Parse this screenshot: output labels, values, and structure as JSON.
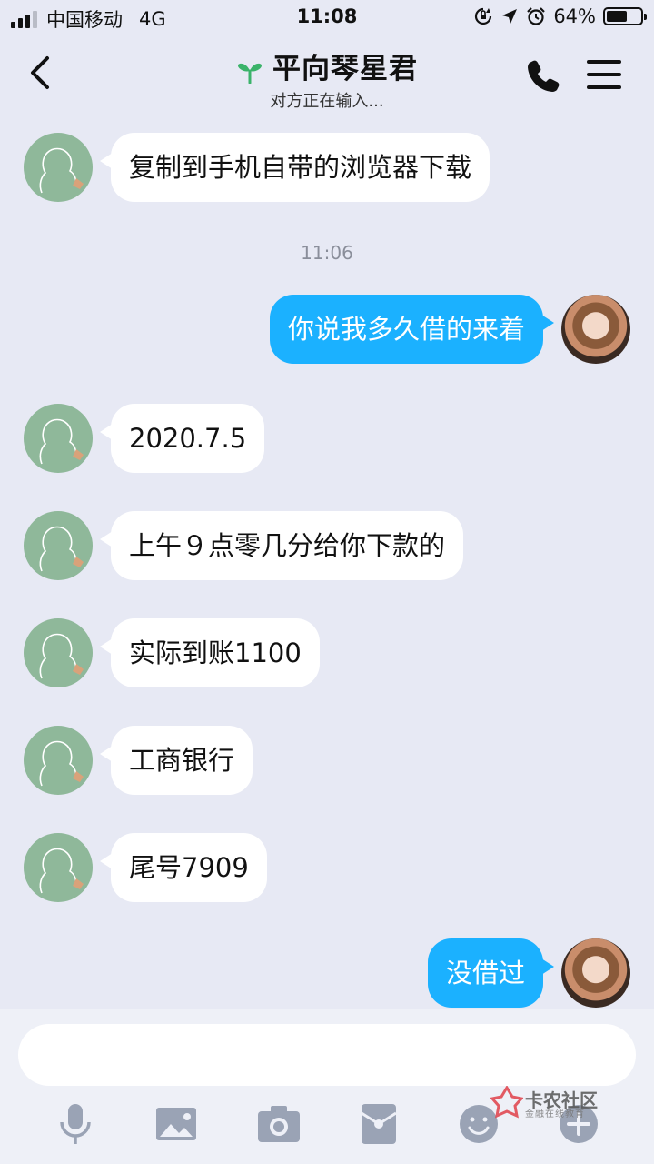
{
  "status": {
    "carrier": "中国移动",
    "network": "4G",
    "time": "11:08",
    "battery_pct": "64%",
    "battery_level": 0.64
  },
  "header": {
    "title": "平向琴星君",
    "subtitle": "对方正在输入..."
  },
  "messages": [
    {
      "side": "left",
      "text": "复制到手机自带的浏览器下载"
    },
    {
      "timestamp": "11:06"
    },
    {
      "side": "right",
      "text": "你说我多久借的来着"
    },
    {
      "side": "left",
      "text": "2020.7.5"
    },
    {
      "side": "left",
      "text": "上午９点零几分给你下款的"
    },
    {
      "side": "left",
      "text": "实际到账1100"
    },
    {
      "side": "left",
      "text": "工商银行"
    },
    {
      "side": "left",
      "text": "尾号7909"
    },
    {
      "side": "right",
      "text": "没借过"
    }
  ],
  "input": {
    "placeholder": ""
  },
  "toolbar": [
    "mic-icon",
    "image-icon",
    "camera-icon",
    "red-packet-icon",
    "emoji-icon",
    "plus-icon"
  ],
  "watermark": {
    "title": "卡农社区",
    "subtitle": "金融在线教育"
  },
  "colors": {
    "accent": "#1bb1ff",
    "background": "#e7e9f4",
    "avatar_left": "#8fb89a"
  }
}
